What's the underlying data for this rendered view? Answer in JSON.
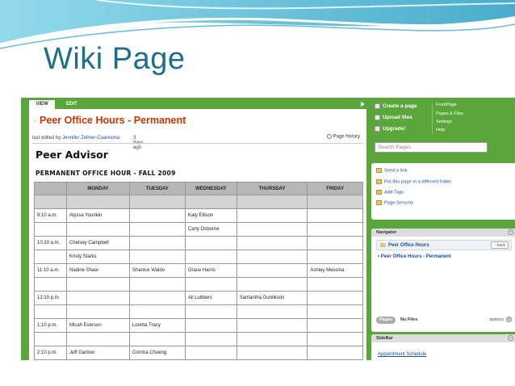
{
  "slide": {
    "title": "Wiki Page"
  },
  "tabs": {
    "view": "VIEW",
    "edit": "EDIT"
  },
  "page": {
    "heading": "Peer Office Hours - Permanent",
    "meta_prefix": "last edited by",
    "editor": "Jennifer Zellner-Cuaresma",
    "ago": "3 days ago",
    "history": "Page history"
  },
  "content": {
    "h1": "Peer Advisor",
    "h2": "PERMANENT OFFICE HOUR - FALL 2009",
    "columns": [
      "",
      "MONDAY",
      "TUESDAY",
      "WEDNESDAY",
      "THURSDAY",
      "FRIDAY"
    ],
    "rows": [
      [
        "",
        "",
        "",
        "",
        "",
        ""
      ],
      [
        "9:10 a.m.",
        "Alyssa Younkin",
        "",
        "Katy Ellison",
        "",
        ""
      ],
      [
        "",
        "",
        "",
        "Carly Osborne",
        "",
        ""
      ],
      [
        "10:10 a.m.",
        "Chelsey Campbell",
        "",
        "",
        "",
        ""
      ],
      [
        "",
        "Kristy Starks",
        "",
        "",
        "",
        ""
      ],
      [
        "11:10 a.m.",
        "Nadine Shaw",
        "Shanice Waldo",
        "Grace Harris",
        "",
        "Ashley Messina"
      ],
      [
        "",
        "",
        "",
        "",
        "",
        ""
      ],
      [
        "12:10 p.m.",
        "",
        "",
        "Ali Lubbers",
        "Samantha Gunlikson",
        ""
      ],
      [
        "",
        "",
        "",
        "",
        "",
        ""
      ],
      [
        "1:10 p.m.",
        "Micah Everson",
        "Loretta Tracy",
        "",
        "",
        ""
      ],
      [
        "",
        "",
        "",
        "",
        "",
        ""
      ],
      [
        "2:10 p.m.",
        "Jeff Gartner",
        "Corrina Chueng",
        "",
        "",
        ""
      ]
    ]
  },
  "actions": {
    "create": "Create a page",
    "upload": "Upload files",
    "upgrade": "Upgrade!",
    "frontpage": "FrontPage",
    "pages_files": "Pages & Files",
    "settings": "Settings",
    "help": "Help",
    "search_placeholder": "Search Pages"
  },
  "tools": {
    "send_link": "Send a link",
    "put_folder": "Put this page in a different folder",
    "add_tags": "Add Tags",
    "security": "Page Security"
  },
  "navigator": {
    "title": "Navigator",
    "folder": "Peer Office Hours",
    "back": "back",
    "item": "Peer Office Hours - Permanent",
    "pages_btn": "Pages",
    "no_files": "No Files",
    "options": "options"
  },
  "sidebar": {
    "title": "SideBar",
    "link": "Appointment Schedule"
  },
  "colors": {
    "brand_green": "#5aa63a",
    "heading_orange": "#cc3300",
    "title_blue": "#1f6e8c"
  }
}
